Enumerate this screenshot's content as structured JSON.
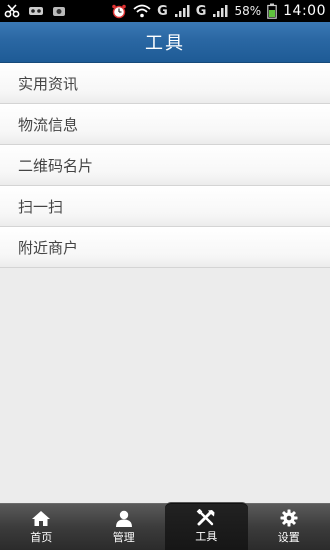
{
  "status_bar": {
    "network_1": "G",
    "network_2": "G",
    "battery_percent": "58%",
    "time": "14:00",
    "icons": [
      "scissors-icon",
      "tape-icon",
      "camera-icon",
      "alarm-icon",
      "wifi-icon",
      "signal-icon",
      "battery-icon"
    ]
  },
  "header": {
    "title": "工具"
  },
  "menu": {
    "items": [
      {
        "label": "实用资讯"
      },
      {
        "label": "物流信息"
      },
      {
        "label": "二维码名片"
      },
      {
        "label": "扫一扫"
      },
      {
        "label": "附近商户"
      }
    ]
  },
  "tabbar": {
    "tabs": [
      {
        "label": "首页",
        "icon": "home-icon"
      },
      {
        "label": "管理",
        "icon": "user-icon"
      },
      {
        "label": "工具",
        "icon": "tools-icon",
        "active": true
      },
      {
        "label": "设置",
        "icon": "gear-icon"
      }
    ]
  },
  "colors": {
    "title_bar": "#2a67a3",
    "tab_bar": "#3c3c3c",
    "list_background": "#ececec"
  }
}
